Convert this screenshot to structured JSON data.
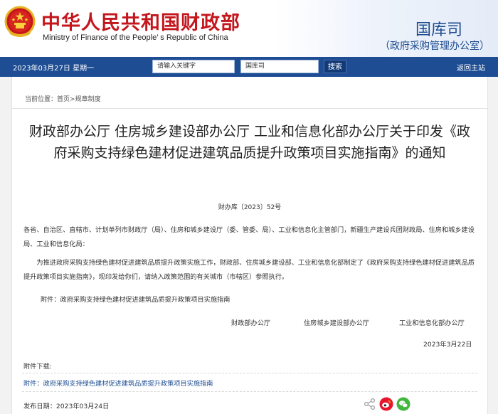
{
  "header": {
    "cn_title": "中华人民共和国财政部",
    "en_title": "Ministry of Finance of the People’ s Republic of China",
    "dept_name": "国库司",
    "dept_sub": "（政府采购管理办公室）"
  },
  "navbar": {
    "date": "2023年03月27日  星期一",
    "keyword_placeholder": "请输入关键字",
    "scope_value": "国库司",
    "search_label": "搜索",
    "home_label": "返回主站"
  },
  "breadcrumb": {
    "prefix": "当前位置：",
    "home": "首页",
    "sep": ">",
    "current": "规章制度"
  },
  "article": {
    "title": "财政部办公厅 住房城乡建设部办公厅 工业和信息化部办公厅关于印发《政府采购支持绿色建材促进建筑品质提升政策项目实施指南》的通知",
    "doc_number": "财办库〔2023〕52号",
    "para1": "各省、自治区、直辖市、计划单列市财政厅（局）、住房和城乡建设厅（委、管委、局）、工业和信息化主管部门，新疆生产建设兵团财政局、住房和城乡建设局、工业和信息化局：",
    "para2": "为推进政府采购支持绿色建材促进建筑品质提升政策实施工作，财政部、住房城乡建设部、工业和信息化部制定了《政府采购支持绿色建材促进建筑品质提升政策项目实施指南》，现印发给你们，请纳入政策范围的有关城市（市辖区）参照执行。",
    "attachment_line": "附件：政府采购支持绿色建材促进建筑品质提升政策项目实施指南",
    "signers": [
      "财政部办公厅",
      "住房城乡建设部办公厅",
      "工业和信息化部办公厅"
    ],
    "sign_date": "2023年3月22日"
  },
  "downloads": {
    "label": "附件下载:",
    "item_label": "附件：",
    "item_link": "政府采购支持绿色建材促进建筑品质提升政策项目实施指南"
  },
  "footer": {
    "pub_date": "发布日期：2023年03月24日"
  },
  "colors": {
    "brand_red": "#c4161c",
    "nav_blue": "#1e4d93",
    "weibo_red": "#e6162d",
    "wechat_green": "#43b73d"
  }
}
